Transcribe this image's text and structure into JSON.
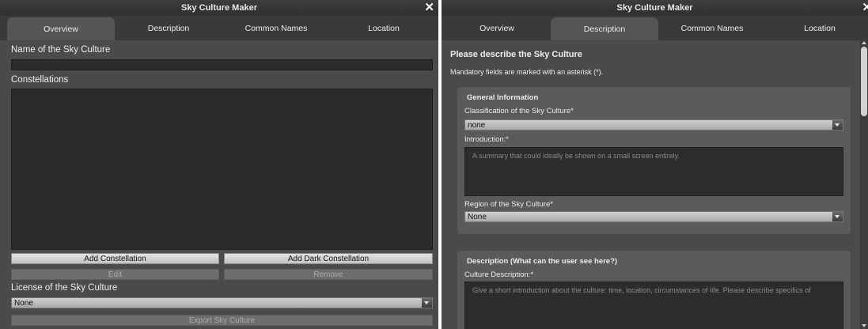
{
  "left": {
    "title": "Sky Culture Maker",
    "close": "✕",
    "tabs": [
      "Overview",
      "Description",
      "Common Names",
      "Location"
    ],
    "name_label": "Name of the Sky Culture",
    "name_value": "",
    "constellations_label": "Constellations",
    "add_constellation": "Add Constellation",
    "add_dark_constellation": "Add Dark Constellation",
    "edit": "Edit",
    "remove": "Remove",
    "license_label": "License of the Sky Culture",
    "license_value": "None",
    "export": "Export Sky Culture"
  },
  "right": {
    "title": "Sky Culture Maker",
    "close": "✕",
    "tabs": [
      "Overview",
      "Description",
      "Common Names",
      "Location"
    ],
    "heading": "Please describe the Sky Culture",
    "mandatory_note": "Mandatory fields are marked with an asterisk (*).",
    "general": {
      "title": "General Information",
      "classification_label": "Classification of the Sky Culture*",
      "classification_value": "none",
      "intro_label": "Introduction:*",
      "intro_placeholder": "A summary that could ideally be shown on a small screen entirely.",
      "region_label": "Region of the Sky Culture*",
      "region_value": "None"
    },
    "description": {
      "title": "Description (What can the user see here?)",
      "culture_label": "Culture Description:*",
      "culture_placeholder": "Give a short introduction about the culture: time, location, circumstances of life. Please describe specifics of"
    }
  }
}
